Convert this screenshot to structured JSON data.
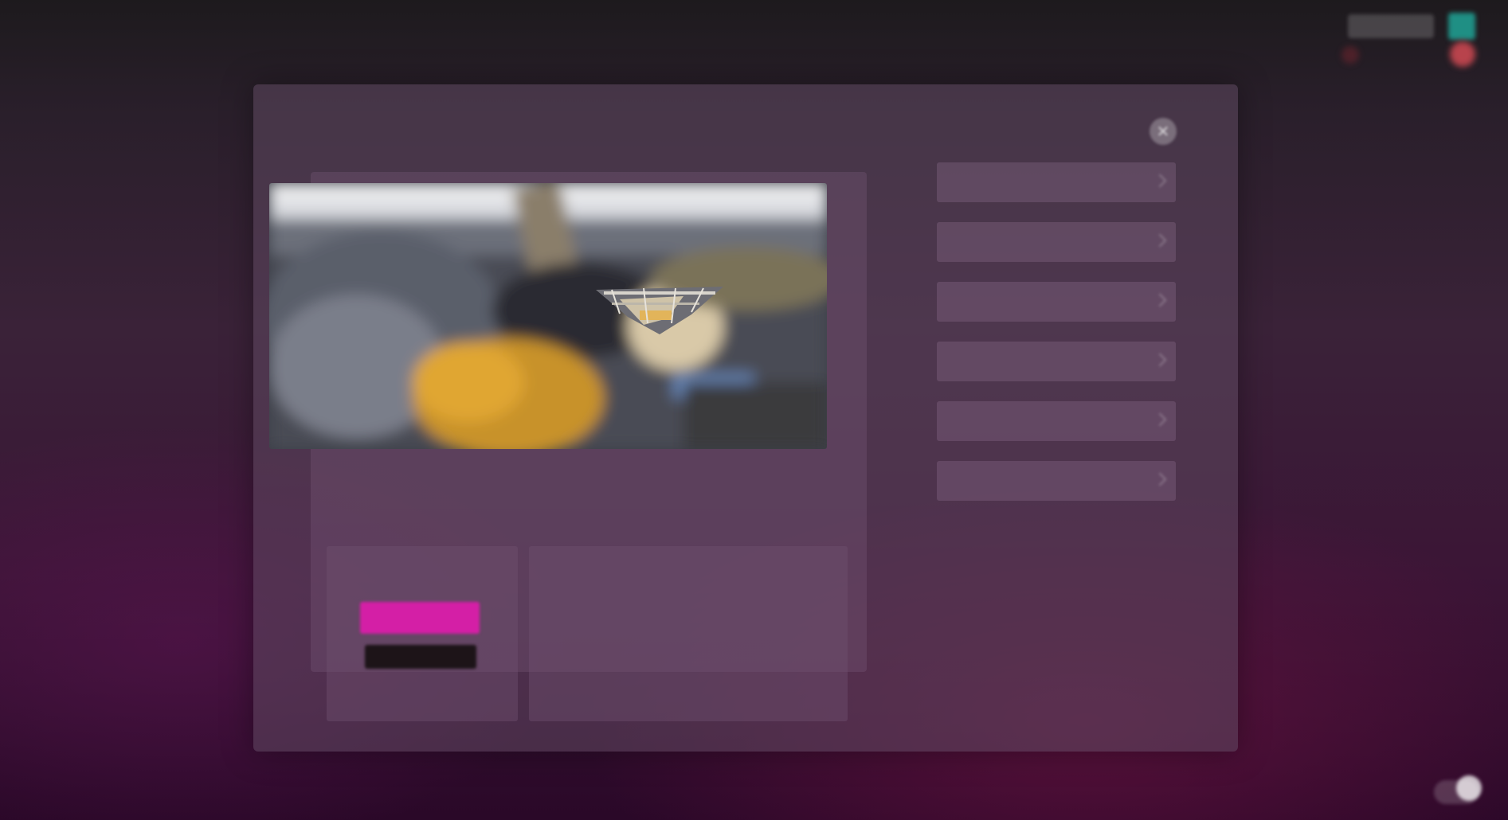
{
  "hud": {
    "player_name": "",
    "stats": [
      "",
      "",
      ""
    ]
  },
  "dialog": {
    "title": "",
    "close_glyph": "✕"
  },
  "hero_image": {
    "description_icon": "mining-excavator-image"
  },
  "actions": {
    "primary_label": "",
    "secondary_label": ""
  },
  "info": {
    "title": "",
    "line1": "",
    "line2": ""
  },
  "menu": {
    "items": [
      {
        "label": ""
      },
      {
        "label": ""
      },
      {
        "label": ""
      },
      {
        "label": ""
      },
      {
        "label": ""
      },
      {
        "label": ""
      }
    ]
  },
  "colors": {
    "accent": "#d41fa6",
    "teal": "#1f8f84",
    "alert": "#b8434c"
  }
}
